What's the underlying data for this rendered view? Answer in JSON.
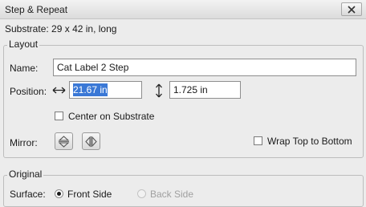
{
  "dialog": {
    "title": "Step & Repeat"
  },
  "substrate": {
    "label": "Substrate:",
    "value": "29 x 42 in, long"
  },
  "layout": {
    "legend": "Layout",
    "name_label": "Name:",
    "name_value": "Cat Label 2 Step",
    "position_label": "Position:",
    "horizontal_value": "21.67 in",
    "vertical_value": "1.725 in",
    "center_on_substrate_label": "Center on Substrate",
    "center_on_substrate_checked": false,
    "mirror_label": "Mirror:",
    "wrap_label": "Wrap Top to Bottom",
    "wrap_checked": false
  },
  "original": {
    "legend": "Original",
    "surface_label": "Surface:",
    "options": [
      "Front Side",
      "Back Side"
    ],
    "selected": "Front Side"
  },
  "icons": {
    "close": "close-icon",
    "horizontal": "horizontal-arrow-icon",
    "vertical": "vertical-arrow-icon",
    "mirror_vertical": "mirror-vertical-icon",
    "mirror_horizontal": "mirror-horizontal-icon"
  },
  "colors": {
    "selection": "#3a78d6",
    "background": "#ececec"
  }
}
